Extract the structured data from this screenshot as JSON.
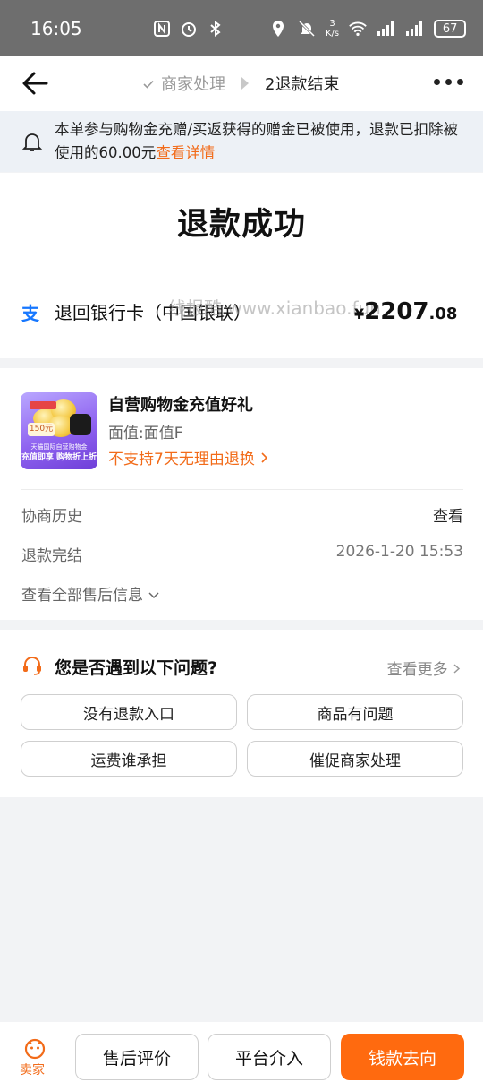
{
  "status_bar": {
    "time": "16:05",
    "net_speed_value": "3",
    "net_speed_unit": "K/s",
    "battery": "67",
    "icons": [
      "nfc-icon",
      "alarm-icon",
      "bluetooth-icon",
      "location-icon",
      "mute-icon",
      "wifi-icon",
      "signal-icon",
      "signal-icon",
      "battery-icon"
    ]
  },
  "nav": {
    "step1": "商家处理",
    "step2": "2退款结束"
  },
  "notice": {
    "text": "本单参与购物金充赠/买返获得的赠金已被使用，退款已扣除被使用的60.00元",
    "link": "查看详情"
  },
  "result": {
    "title": "退款成功",
    "method": "退回银行卡（中国银联）",
    "currency": "¥",
    "amount_int": "2207",
    "amount_dec": ".08",
    "watermark": "线报酷 www.xianbao.fun"
  },
  "product": {
    "name": "自营购物金充值好礼",
    "value": "面值:面值F",
    "no_refund": "不支持7天无理由退换",
    "thumb_tag": "150元",
    "thumb_line1": "天猫国际自营购物金",
    "thumb_line2": "充值即享 购物折上折"
  },
  "info_rows": [
    {
      "label": "协商历史",
      "value": "查看"
    },
    {
      "label": "退款完结",
      "value": "2026-1-20 15:53"
    }
  ],
  "view_all": "查看全部售后信息",
  "questions": {
    "title": "您是否遇到以下问题?",
    "more": "查看更多",
    "buttons": [
      "没有退款入口",
      "商品有问题",
      "运费谁承担",
      "催促商家处理"
    ]
  },
  "bottom": {
    "seller": "卖家",
    "review": "售后评价",
    "platform": "平台介入",
    "money_flow": "钱款去向"
  },
  "colors": {
    "accent": "#f26b19",
    "primary_button": "#ff6a0f",
    "alipay_blue": "#1677ff"
  }
}
